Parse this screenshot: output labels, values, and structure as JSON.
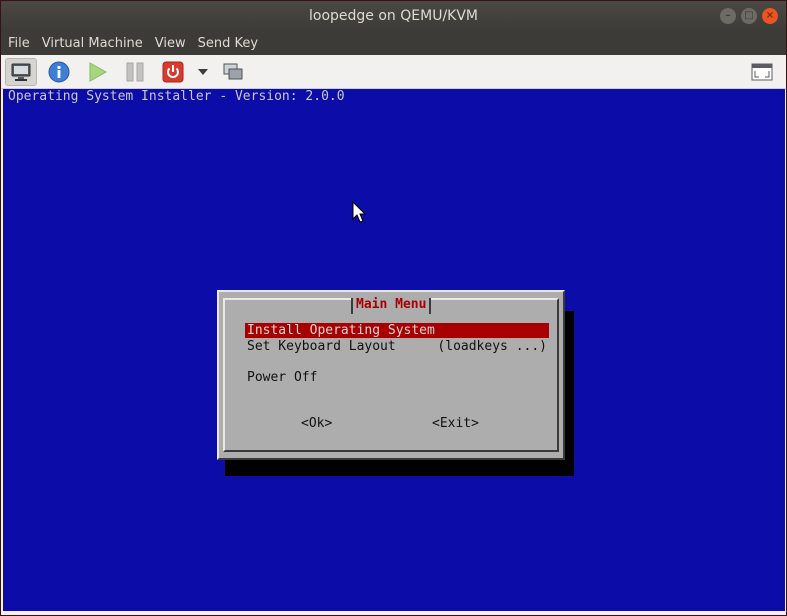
{
  "window": {
    "title": "loopedge on QEMU/KVM",
    "controls": {
      "minimize": "–",
      "maximize": "□",
      "close": "×"
    }
  },
  "menubar": {
    "items": [
      "File",
      "Virtual Machine",
      "View",
      "Send Key"
    ]
  },
  "toolbar": {
    "buttons": [
      "console-icon",
      "info-icon",
      "run-icon",
      "pause-icon",
      "shutdown-icon",
      "dropdown-arrow-icon",
      "snapshots-icon",
      "fullscreen-icon"
    ]
  },
  "screen": {
    "header": "Operating System Installer - Version: 2.0.0",
    "dialog": {
      "title": "Main Menu",
      "items": [
        {
          "label": "Install Operating System",
          "hint": "",
          "selected": true
        },
        {
          "label": "Set Keyboard Layout",
          "hint": "(loadkeys ...)",
          "selected": false
        },
        {
          "label": "Power Off",
          "hint": "",
          "selected": false
        }
      ],
      "ok_label": "<Ok>",
      "exit_label": "<Exit>"
    }
  },
  "colors": {
    "screen_bg": "#0c0ca8",
    "dialog_bg": "#adadad",
    "selection": "#a80000",
    "title_text": "#a80000"
  }
}
